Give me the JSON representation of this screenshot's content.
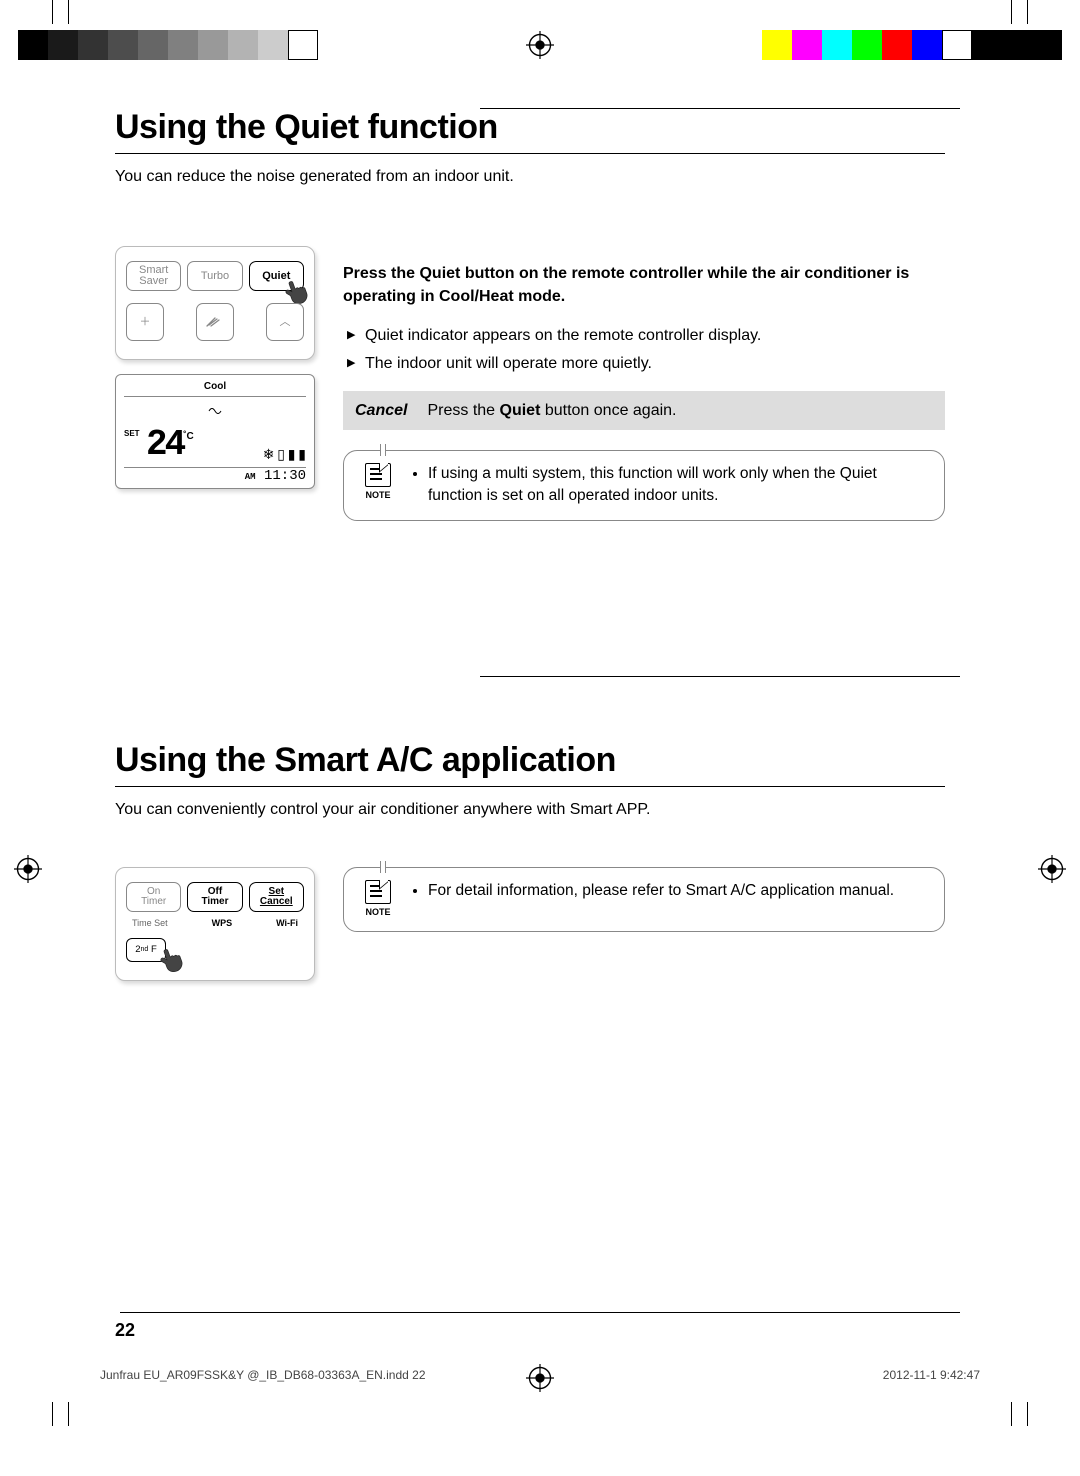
{
  "section1": {
    "title": "Using the Quiet function",
    "subtitle": "You can reduce the noise generated from an indoor unit.",
    "remote": {
      "btn_smart_saver": "Smart\nSaver",
      "btn_turbo": "Turbo",
      "btn_quiet": "Quiet"
    },
    "lcd": {
      "mode": "Cool",
      "set_label": "SET",
      "temp": "24",
      "unit": "˚C",
      "ampm": "AM",
      "time": "11:30"
    },
    "instruction_prefix": "Press the ",
    "instruction_bold": "Quiet",
    "instruction_mid": " button on the remote controller while the air conditioner is operating in Cool/Heat mode.",
    "bullets": [
      "Quiet indicator appears on the remote controller display.",
      "The indoor unit will operate more quietly."
    ],
    "cancel_label": "Cancel",
    "cancel_text_pre": "Press the ",
    "cancel_text_bold": "Quiet",
    "cancel_text_post": " button once again.",
    "note_label": "NOTE",
    "note_text": "If using a multi system, this function will work only when the Quiet function is set on all operated indoor units."
  },
  "section2": {
    "title": "Using the Smart A/C application",
    "subtitle": "You can conveniently control your air conditioner anywhere with Smart APP.",
    "remote": {
      "btn_on_timer": "On\nTimer",
      "btn_off_timer": "Off\nTimer",
      "btn_set_cancel": "Set\nCancel",
      "sub_timeset": "Time Set",
      "sub_wps": "WPS",
      "sub_wifi": "Wi-Fi",
      "btn_2ndf": "2nd F"
    },
    "note_label": "NOTE",
    "note_text": "For detail information, please refer to Smart A/C application manual."
  },
  "page_number": "22",
  "footer_file": "Junfrau EU_AR09FSSK&Y @_IB_DB68-03363A_EN.indd   22",
  "footer_timestamp": "2012-11-1   9:42:47",
  "colorbar_left": [
    "#000",
    "#1a1a1a",
    "#333",
    "#4d4d4d",
    "#666",
    "#808080",
    "#999",
    "#b3b3b3",
    "#ccc",
    "#fff"
  ],
  "colorbar_right": [
    "#ff0",
    "#f0f",
    "#0ff",
    "#0f0",
    "#f00",
    "#00f",
    "#fff",
    "#000",
    "#000",
    "#000"
  ]
}
